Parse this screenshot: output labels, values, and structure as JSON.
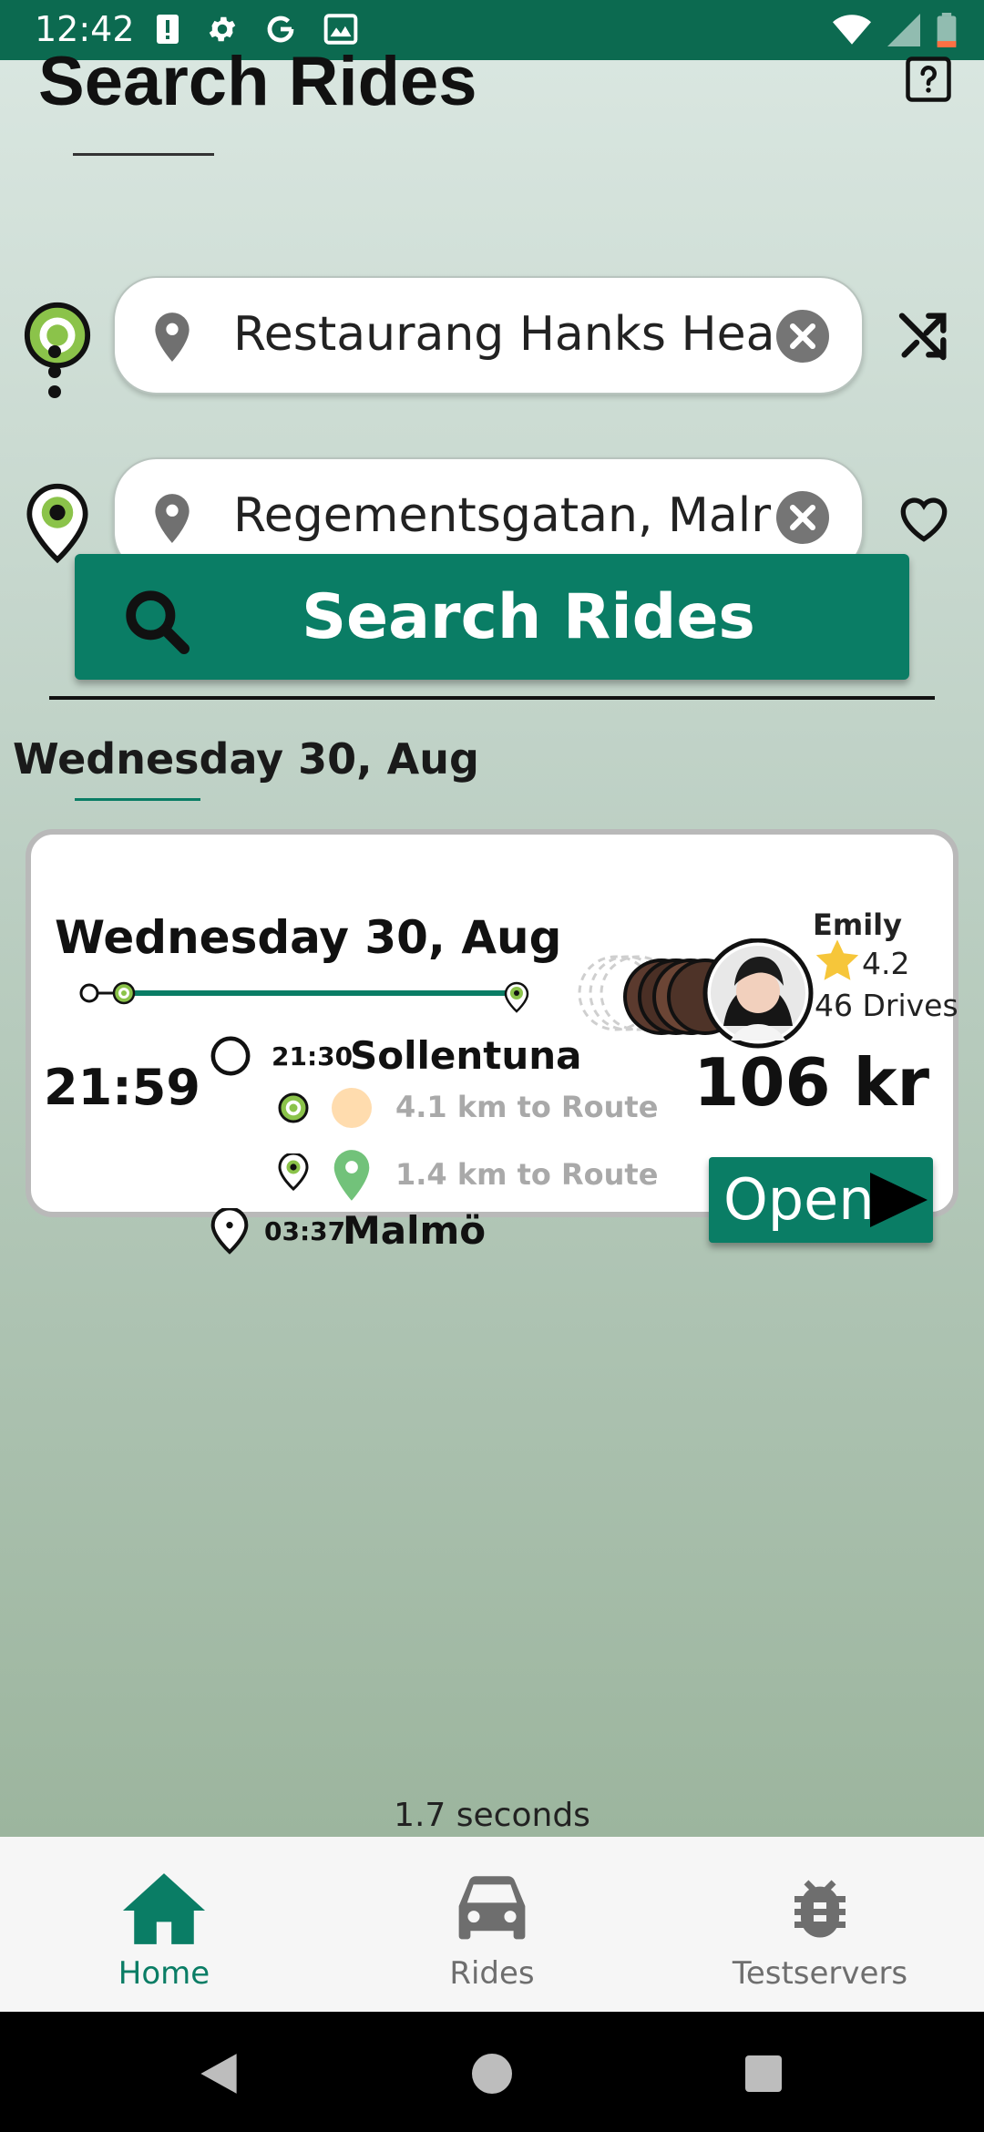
{
  "status_bar": {
    "time": "12:42"
  },
  "header": {
    "title": "Search Rides"
  },
  "search": {
    "from_value": "Restaurang Hanks Heaven",
    "to_value": "Regementsgatan, Malmö, Sweden",
    "button_label": "Search Rides"
  },
  "results": {
    "date_header": "Wednesday 30, Aug"
  },
  "ride": {
    "date": "Wednesday 30, Aug",
    "departure_time": "21:59",
    "start_time": "21:30",
    "start_city": "Sollentuna",
    "pickup_distance": "4.1 km to Route",
    "dropoff_distance": "1.4 km to Route",
    "end_time": "03:37",
    "end_city": "Malmö",
    "driver_name": "Emily",
    "driver_rating": "4.2",
    "driver_drives": "46 Drives",
    "price": "106 kr",
    "open_label": "Open"
  },
  "timing": "1.7 seconds",
  "bottom_nav": {
    "home": "Home",
    "rides": "Rides",
    "testservers": "Testservers"
  },
  "colors": {
    "accent": "#0a7d65",
    "status_bar": "#0c6a50",
    "marker_green": "#8bc34a"
  },
  "icons": [
    "help-icon",
    "shuffle-icon",
    "heart-icon",
    "search-icon",
    "location-pin-icon",
    "clear-icon",
    "star-icon",
    "home-icon",
    "car-icon",
    "bug-icon"
  ]
}
